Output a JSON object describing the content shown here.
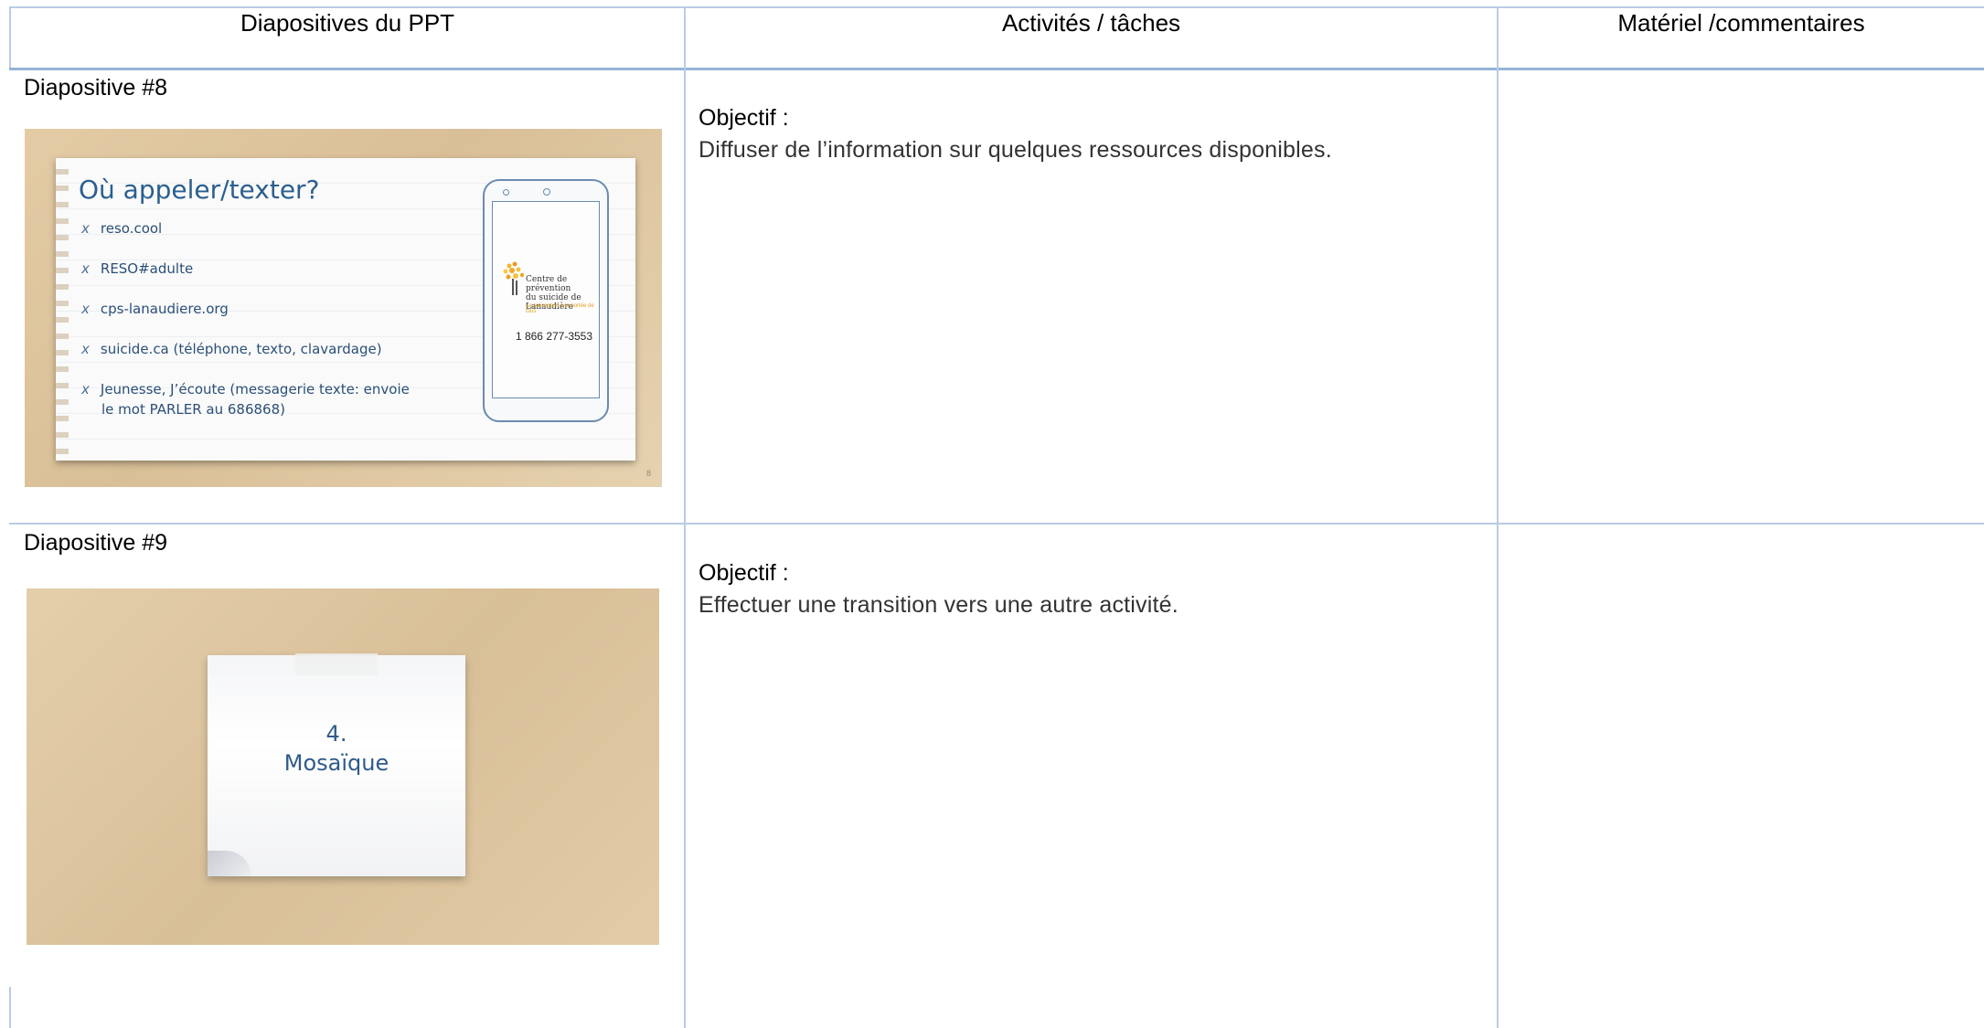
{
  "table": {
    "headers": [
      "Diapositives du PPT",
      "Activités / tâches",
      "Matériel /commentaires"
    ],
    "rows": [
      {
        "slide_label": "Diapositive #8",
        "objective_label": "Objectif :",
        "objective_text": "Diffuser de l’information sur quelques ressources disponibles.",
        "comment": ""
      },
      {
        "slide_label": "Diapositive #9",
        "objective_label": "Objectif :",
        "objective_text": "Effectuer une transition vers une autre activité.",
        "comment": ""
      }
    ]
  },
  "slide8": {
    "title": "Où appeler/texter?",
    "items": [
      "reso.cool",
      "RESO#adulte",
      "cps-lanaudiere.org",
      "suicide.ca (téléphone, texto, clavardage)",
      "Jeunesse, J’écoute  (messagerie texte: envoie",
      "le mot PARLER au 686868)"
    ],
    "bullet": "x",
    "logo_line1": "Centre de prévention",
    "logo_line2": "du suicide de Lanaudière",
    "logo_tagline": "La prévention à la portée de tous",
    "phone": "1 866 277-3553",
    "page_number": "8"
  },
  "slide9": {
    "number": "4.",
    "word": "Mosaïque"
  },
  "colors": {
    "grid_line": "#b8cce4",
    "header_rule": "#95b3d7",
    "slide_text": "#2b5f8f"
  }
}
